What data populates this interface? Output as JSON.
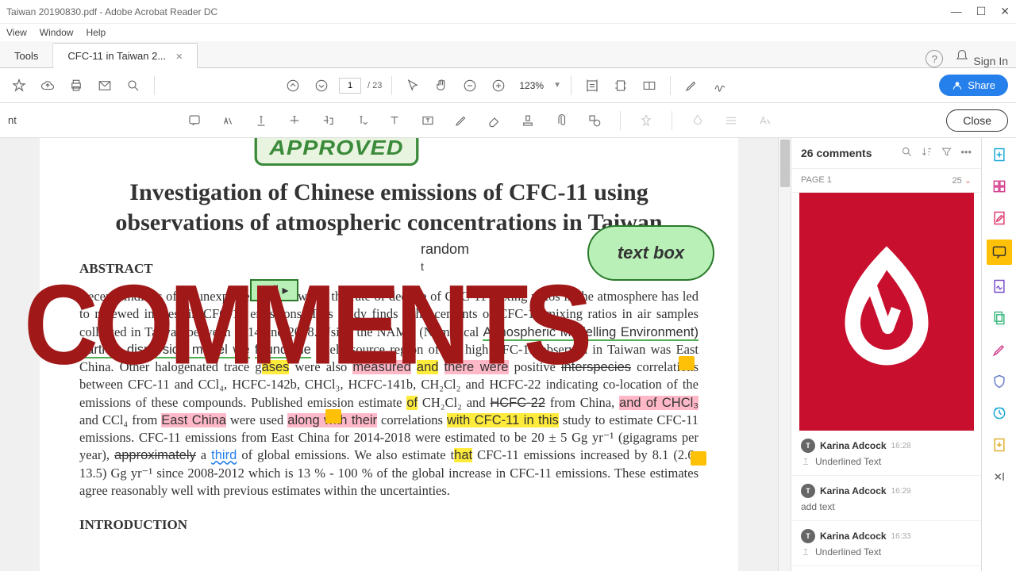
{
  "window": {
    "title": "Taiwan 20190830.pdf - Adobe Acrobat Reader DC"
  },
  "menu": {
    "view": "View",
    "window": "Window",
    "help": "Help"
  },
  "tabs": {
    "tools": "Tools",
    "doc": "CFC-11 in Taiwan 2..."
  },
  "toolbar": {
    "page_current": "1",
    "page_total": "/ 23",
    "zoom": "123%",
    "signin": "Sign In",
    "share": "Share",
    "close": "Close",
    "left_label": "nt"
  },
  "document": {
    "stamp": "APPROVED",
    "title": "Investigation of Chinese emissions of CFC-11 using observations of atmospheric concentrations in Taiwan",
    "abstract_heading": "ABSTRACT",
    "intro_heading": "INTRODUCTION",
    "random_label": "random",
    "textbox_label": "text box",
    "callout_label": "call"
  },
  "overlay": {
    "text": "COMMENTS"
  },
  "comments": {
    "count_label": "26 comments",
    "page_label": "PAGE 1",
    "page_count": "25",
    "items": [
      {
        "author": "Karina Adcock",
        "time": "16:28",
        "body": "Underlined Text",
        "type": "T"
      },
      {
        "author": "Karina Adcock",
        "time": "16:29",
        "body": "add text",
        "type": "Ta"
      },
      {
        "author": "Karina Adcock",
        "time": "16:33",
        "body": "Underlined Text",
        "type": "T"
      }
    ]
  }
}
